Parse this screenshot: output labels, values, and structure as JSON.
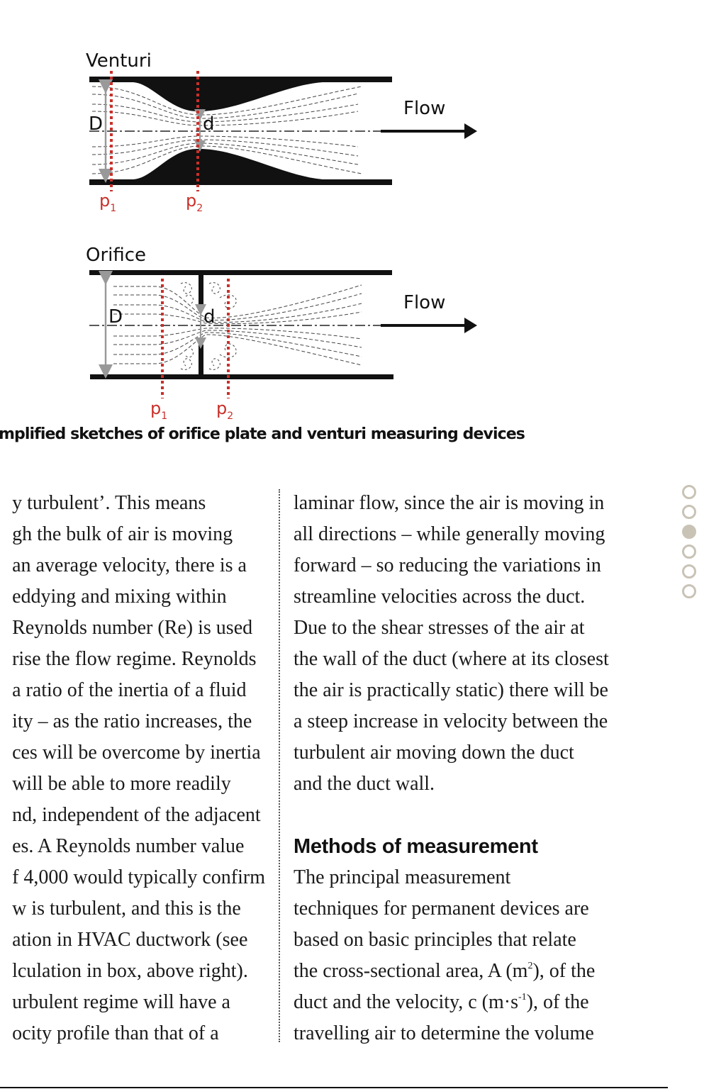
{
  "figure": {
    "venturi": {
      "title": "Venturi",
      "flow_label": "Flow",
      "large_diameter_label": "D",
      "small_diameter_label": "d",
      "p1_label": "p",
      "p1_sub": "1",
      "p2_label": "p",
      "p2_sub": "2"
    },
    "orifice": {
      "title": "Orifice",
      "flow_label": "Flow",
      "large_diameter_label": "D",
      "small_diameter_label": "d",
      "p1_label": "p",
      "p1_sub": "1",
      "p2_label": "p",
      "p2_sub": "2"
    },
    "caption": "mplified sketches of orifice plate and venturi measuring devices",
    "colors": {
      "pressure_tap": "#c8302a",
      "wall": "#111111",
      "dimension": "#999999"
    }
  },
  "article": {
    "left_column": [
      "y turbulent’. This means",
      "gh the bulk of air is moving",
      "an average velocity, there is a",
      " eddying and mixing within",
      " Reynolds number (Re) is used",
      "rise the flow regime. Reynolds",
      "a ratio of the inertia of a fluid",
      "ity – as the ratio increases, the",
      "ces will be overcome by inertia",
      "will be able to more readily",
      "nd, independent of the adjacent",
      "es. A Reynolds number value",
      "f 4,000 would typically confirm",
      "w is turbulent, and this is the",
      "ation in HVAC ductwork (see",
      "lculation in box, above right).",
      "urbulent regime will have a",
      "ocity profile than that of a"
    ],
    "right_column_para1": [
      "laminar flow, since the air is moving in",
      "all directions – while generally moving",
      "forward – so reducing the variations in",
      "streamline velocities across the duct.",
      "Due to the shear stresses of the air at",
      "the wall of the duct (where at its closest",
      "the air is practically static) there will be",
      "a steep increase in velocity between the",
      "turbulent air moving down the duct",
      "and the duct wall."
    ],
    "section_heading": "Methods of measurement",
    "right_column_para2": {
      "line1": "The principal measurement",
      "line2": "techniques for permanent devices are",
      "line3": "based on basic principles that relate",
      "line4_pre": "the cross-sectional area, A (m",
      "line4_sup": "2",
      "line4_post": "), of the",
      "line5_pre": "duct and the velocity, c (m·s",
      "line5_sup": "-1",
      "line5_post": "), of the",
      "line6": "travelling air to determine the volume"
    }
  },
  "page_indicator": {
    "total": 6,
    "active_index": 2,
    "color": "#c9c3b6"
  }
}
